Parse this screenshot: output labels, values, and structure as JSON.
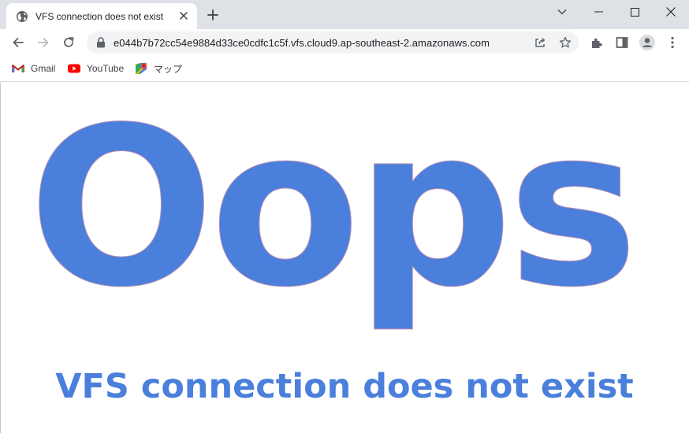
{
  "browser": {
    "tab": {
      "title": "VFS connection does not exist",
      "favicon": "globe-icon"
    },
    "new_tab_icon": "plus-icon",
    "window_controls": [
      "chevron-down-icon",
      "minimize-icon",
      "maximize-icon",
      "close-icon"
    ],
    "address_bar": {
      "url": "e044b7b72cc54e9884d33ce0cdfc1c5f.vfs.cloud9.ap-southeast-2.amazonaws.com",
      "security_icon": "lock-icon"
    },
    "bookmarks": [
      {
        "label": "Gmail",
        "icon": "gmail-icon"
      },
      {
        "label": "YouTube",
        "icon": "youtube-icon"
      },
      {
        "label": "マップ",
        "icon": "maps-icon"
      }
    ]
  },
  "page": {
    "heading": "Oops",
    "message": "VFS connection does not exist",
    "accent_color": "#4a7fdb"
  }
}
